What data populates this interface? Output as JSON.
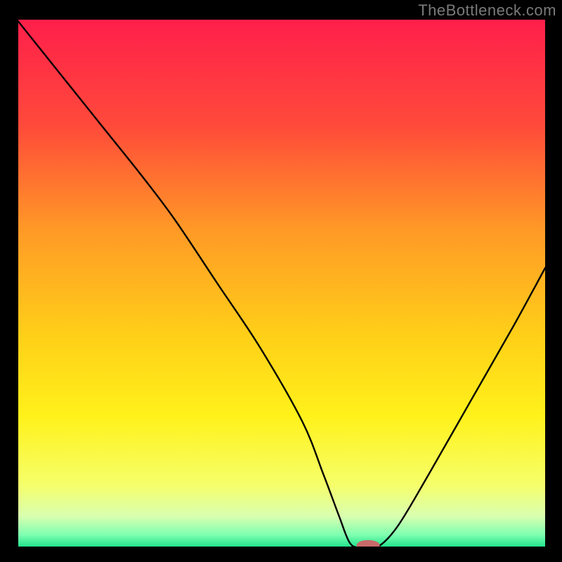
{
  "watermark": "TheBottleneck.com",
  "chart_data": {
    "type": "line",
    "title": "",
    "xlabel": "",
    "ylabel": "",
    "xlim": [
      0,
      100
    ],
    "ylim": [
      0,
      100
    ],
    "background_gradient_stops": [
      {
        "offset": 0.0,
        "color": "#ff1f4b"
      },
      {
        "offset": 0.2,
        "color": "#ff4a3a"
      },
      {
        "offset": 0.4,
        "color": "#ff9a26"
      },
      {
        "offset": 0.6,
        "color": "#ffd018"
      },
      {
        "offset": 0.75,
        "color": "#fff11a"
      },
      {
        "offset": 0.88,
        "color": "#f6ff6a"
      },
      {
        "offset": 0.94,
        "color": "#d9ffb0"
      },
      {
        "offset": 0.975,
        "color": "#7fffb0"
      },
      {
        "offset": 1.0,
        "color": "#18e08a"
      }
    ],
    "series": [
      {
        "name": "bottleneck-curve",
        "x": [
          0,
          8,
          16,
          24,
          30,
          38,
          46,
          54,
          58,
          61,
          63,
          65,
          68,
          72,
          78,
          86,
          94,
          100
        ],
        "y": [
          100,
          90,
          80,
          70,
          62,
          50,
          38,
          24,
          14,
          6,
          1,
          0,
          0,
          4,
          14,
          28,
          42,
          53
        ]
      }
    ],
    "marker": {
      "name": "optimal-point",
      "x": 66.5,
      "y": 0.5,
      "rx": 2.2,
      "ry": 1.0,
      "color": "#c96a6a"
    },
    "axis_color": "#000000",
    "curve_color": "#000000",
    "curve_width": 2.4
  }
}
